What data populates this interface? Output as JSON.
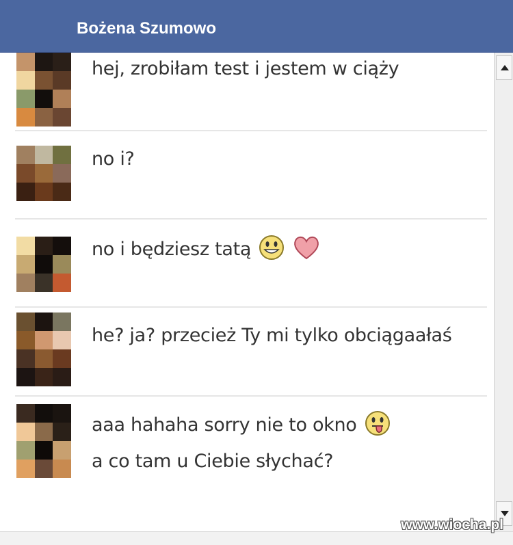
{
  "header": {
    "contact_name": "Bożena Szumowo"
  },
  "colors": {
    "header_bg": "#4b67a0",
    "text": "#333333"
  },
  "messages": [
    {
      "text": "hej, zrobiłam test i jestem w ciąży",
      "sender": "contact"
    },
    {
      "text": "no i?",
      "sender": "self"
    },
    {
      "text": "no i będziesz tatą",
      "sender": "contact",
      "icons": [
        "smile-emoji",
        "heart-emoji"
      ]
    },
    {
      "text": "he? ja? przecież Ty mi tylko obciągaałaś",
      "sender": "self"
    },
    {
      "text": "aaa hahaha sorry nie to okno",
      "text2": "a co tam u Ciebie słychać?",
      "sender": "contact",
      "icons": [
        "tongue-out-emoji"
      ]
    }
  ],
  "watermark": "www.wiocha.pl"
}
